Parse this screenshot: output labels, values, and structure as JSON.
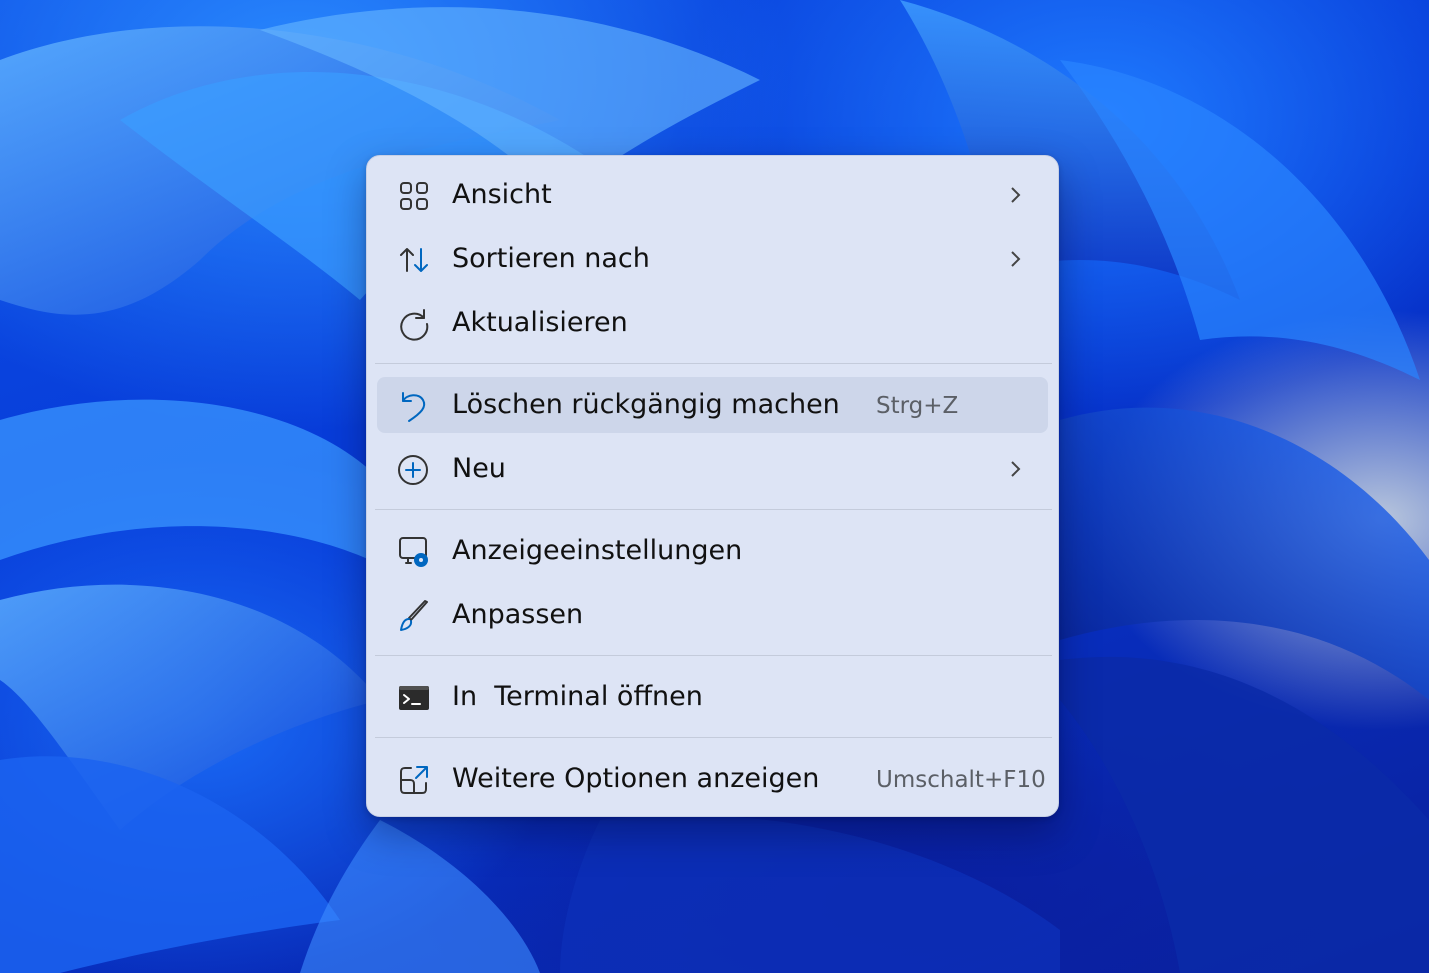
{
  "wallpaper": {
    "name": "Windows 11 Bloom"
  },
  "menu": {
    "items": [
      {
        "label": "Ansicht",
        "icon": "grid-icon",
        "shortcut": "",
        "submenu": true
      },
      {
        "label": "Sortieren nach",
        "icon": "sort-icon",
        "shortcut": "",
        "submenu": true
      },
      {
        "label": "Aktualisieren",
        "icon": "refresh-icon",
        "shortcut": "",
        "submenu": false
      },
      {
        "label": "Löschen rückgängig machen",
        "icon": "undo-icon",
        "shortcut": "Strg+Z",
        "submenu": false,
        "highlighted": true
      },
      {
        "label": "Neu",
        "icon": "add-circle-icon",
        "shortcut": "",
        "submenu": true
      },
      {
        "label": "Anzeigeeinstellungen",
        "icon": "display-settings-icon",
        "shortcut": "",
        "submenu": false
      },
      {
        "label": "Anpassen",
        "icon": "brush-icon",
        "shortcut": "",
        "submenu": false
      },
      {
        "label": "In  Terminal öffnen",
        "icon": "terminal-icon",
        "shortcut": "",
        "submenu": false
      },
      {
        "label": "Weitere Optionen anzeigen",
        "icon": "open-external-icon",
        "shortcut": "Umschalt+F10",
        "submenu": false
      }
    ]
  },
  "colors": {
    "accent": "#0067c0",
    "menu_background": "#dde4f5",
    "hover_background": "#cdd6ea"
  }
}
